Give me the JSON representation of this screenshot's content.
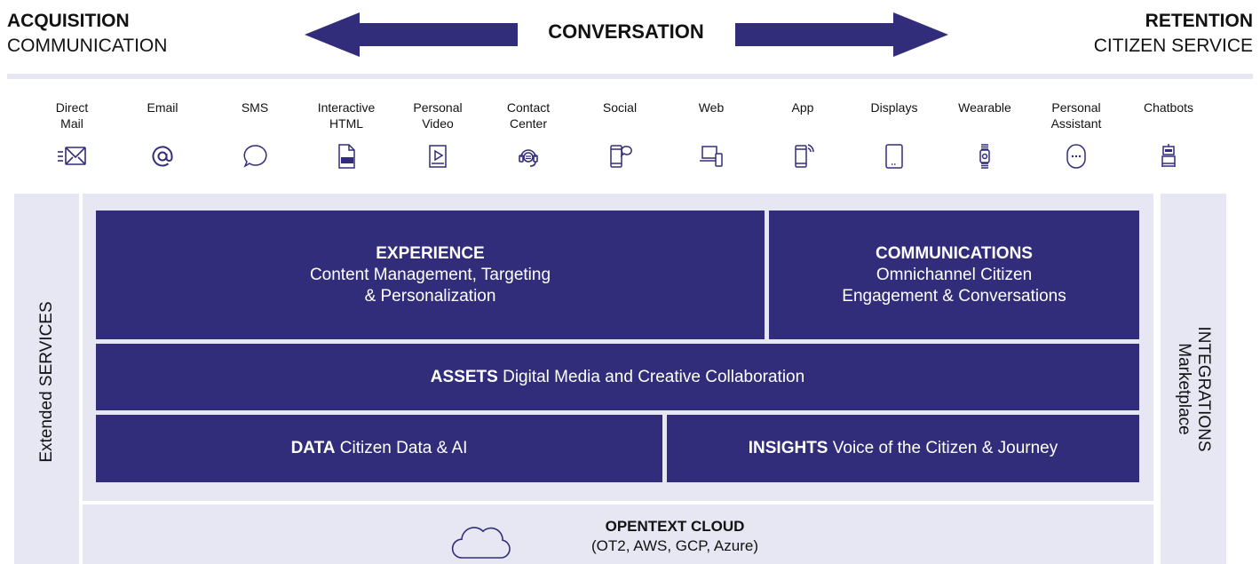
{
  "header": {
    "left_bold": "ACQUISITION",
    "left_light": "COMMUNICATION",
    "center": "CONVERSATION",
    "right_bold": "RETENTION",
    "right_light": "CITIZEN SERVICE"
  },
  "channels": [
    {
      "label1": "Direct",
      "label2": "Mail",
      "icon": "mail-icon"
    },
    {
      "label1": "Email",
      "label2": "",
      "icon": "at-icon"
    },
    {
      "label1": "SMS",
      "label2": "",
      "icon": "chat-bubble-icon"
    },
    {
      "label1": "Interactive",
      "label2": "HTML",
      "icon": "html-file-icon"
    },
    {
      "label1": "Personal",
      "label2": "Video",
      "icon": "video-icon"
    },
    {
      "label1": "Contact",
      "label2": "Center",
      "icon": "headset-icon"
    },
    {
      "label1": "Social",
      "label2": "",
      "icon": "social-phone-icon"
    },
    {
      "label1": "Web",
      "label2": "",
      "icon": "laptop-phone-icon"
    },
    {
      "label1": "App",
      "label2": "",
      "icon": "phone-wireless-icon"
    },
    {
      "label1": "Displays",
      "label2": "",
      "icon": "tablet-icon"
    },
    {
      "label1": "Wearable",
      "label2": "",
      "icon": "smartwatch-icon"
    },
    {
      "label1": "Personal",
      "label2": "Assistant",
      "icon": "assistant-icon"
    },
    {
      "label1": "Chatbots",
      "label2": "",
      "icon": "robot-icon"
    }
  ],
  "sides": {
    "left": "Extended SERVICES",
    "right_title": "INTEGRATIONS",
    "right_sub": "Marketplace"
  },
  "blocks": {
    "experience": {
      "title": "EXPERIENCE",
      "line1": "Content Management, Targeting",
      "line2": "& Personalization"
    },
    "communications": {
      "title": "COMMUNICATIONS",
      "line1": "Omnichannel Citizen",
      "line2": "Engagement & Conversations"
    },
    "assets": {
      "title": "ASSETS",
      "desc": "Digital Media and Creative Collaboration"
    },
    "data": {
      "title": "DATA",
      "desc": "Citizen Data & AI"
    },
    "insights": {
      "title": "INSIGHTS",
      "desc": "Voice of the Citizen & Journey"
    }
  },
  "cloud": {
    "title": "OPENTEXT CLOUD",
    "sub": "(OT2, AWS, GCP, Azure)"
  },
  "colors": {
    "primary": "#312d7b",
    "panel": "#e6e7f3"
  }
}
